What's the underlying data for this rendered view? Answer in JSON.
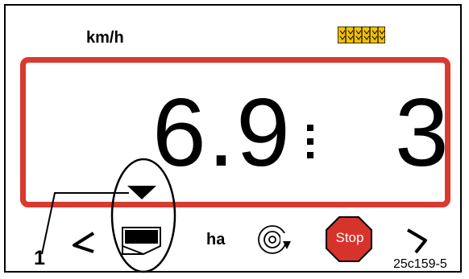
{
  "display": {
    "unit": "km/h",
    "speed_value": "6.9",
    "tramline_count": "3"
  },
  "softkeys": {
    "ha_label": "ha",
    "stop_label": "Stop"
  },
  "annotation": {
    "callout_number": "1",
    "reference_code": "25c159-5"
  },
  "icons": [
    "tramline-icon",
    "arrow-down-icon",
    "hopper-level-icon",
    "chevron-left-icon",
    "rotation-sensor-icon",
    "stop-sign-icon",
    "chevron-right-icon"
  ],
  "colors": {
    "display_border": "#d93a30",
    "stop_sign": "#d6332b",
    "tramline_fill": "#f2c200"
  }
}
